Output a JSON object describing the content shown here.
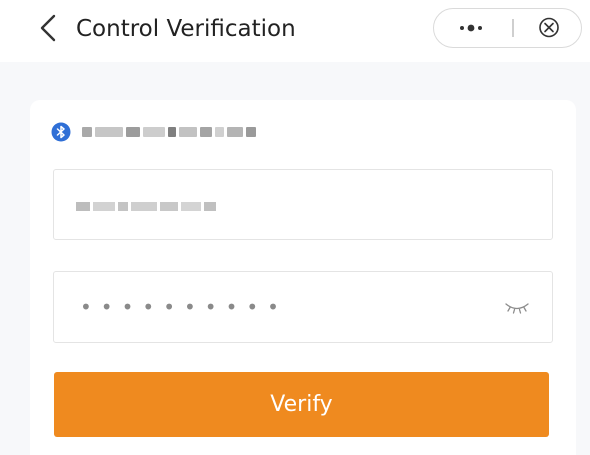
{
  "header": {
    "title": "Control Verification",
    "back_icon": "chevron-left-icon",
    "capsule": {
      "more_icon": "more-dots-icon",
      "close_icon": "close-circle-icon"
    }
  },
  "device": {
    "icon": "bluetooth-icon",
    "name_blurred": true
  },
  "form": {
    "username": {
      "value_blurred": true
    },
    "password": {
      "masked_value": "••••••••••",
      "toggle_icon": "eye-closed-icon"
    },
    "verify_label": "Verify"
  },
  "colors": {
    "accent": "#ef8a1f",
    "bluetooth": "#2f6fd6",
    "page_bg": "#f7f8fa",
    "card_bg": "#ffffff",
    "border": "#e4e4e4"
  }
}
